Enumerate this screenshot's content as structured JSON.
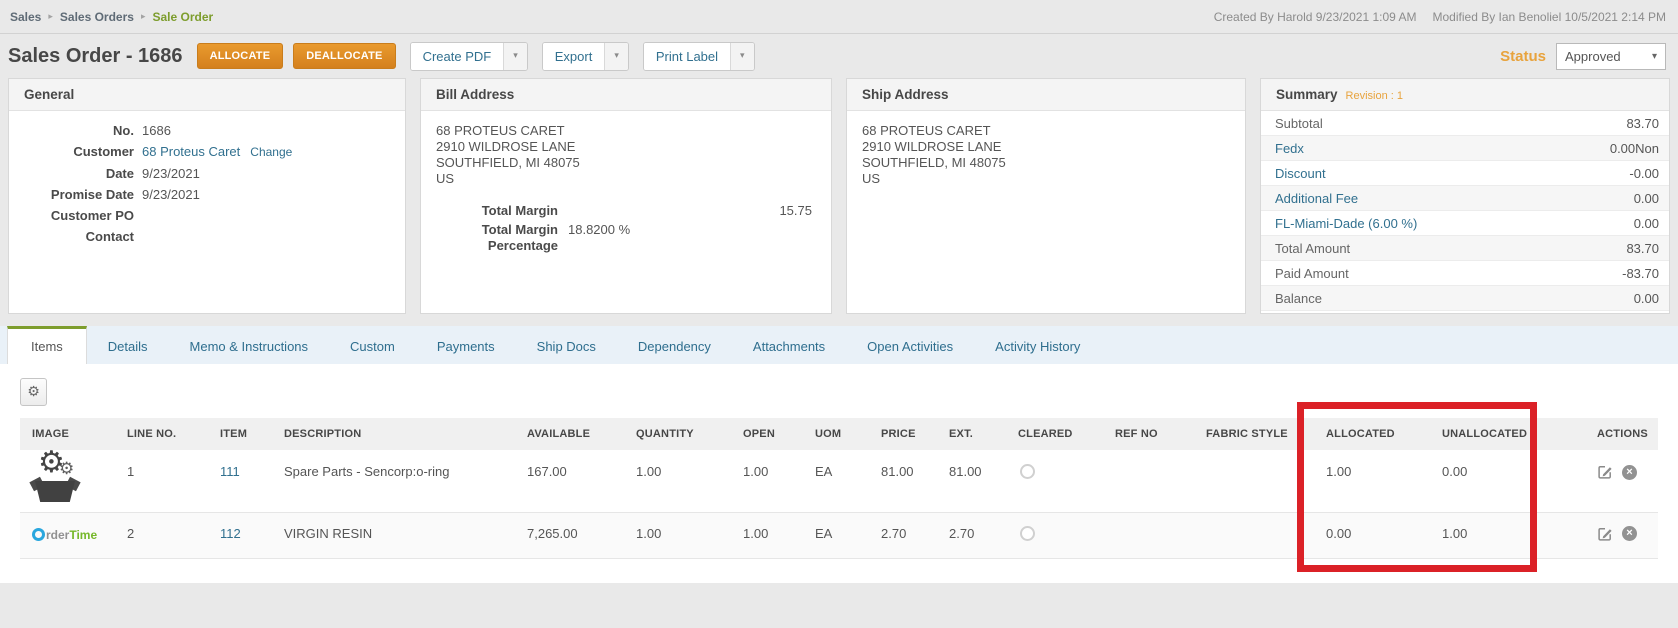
{
  "colors": {
    "accent_orange": "#de8c25",
    "accent_green": "#7d9d2d",
    "link_blue": "#31708f",
    "status_orange": "#e8a33d",
    "highlight_red": "#db2127",
    "tabbar_blue": "#e9f1f8"
  },
  "breadcrumb": {
    "items": [
      "Sales",
      "Sales Orders",
      "Sale Order"
    ]
  },
  "audit": {
    "created": "Created By Harold 9/23/2021 1:09 AM",
    "modified": "Modified By Ian Benoliel 10/5/2021 2:14 PM"
  },
  "header": {
    "title": "Sales Order - 1686",
    "allocate_label": "ALLOCATE",
    "deallocate_label": "DEALLOCATE",
    "create_pdf_label": "Create PDF",
    "export_label": "Export",
    "print_label_label": "Print Label",
    "status_label": "Status",
    "status_value": "Approved"
  },
  "general": {
    "title": "General",
    "rows": [
      {
        "label": "No.",
        "value": "1686"
      },
      {
        "label": "Customer",
        "value": "68 Proteus Caret",
        "extra": "Change"
      },
      {
        "label": "Date",
        "value": "9/23/2021"
      },
      {
        "label": "Promise Date",
        "value": "9/23/2021"
      },
      {
        "label": "Customer PO",
        "value": ""
      },
      {
        "label": "Contact",
        "value": ""
      }
    ]
  },
  "bill_address": {
    "title": "Bill Address",
    "lines": [
      "68 PROTEUS CARET",
      "2910 WILDROSE LANE",
      "SOUTHFIELD, MI 48075",
      "US"
    ],
    "margin_rows": [
      {
        "label": "Total Margin",
        "value": "15.75"
      },
      {
        "label": "Total Margin Percentage",
        "value": "18.8200 %"
      }
    ]
  },
  "ship_address": {
    "title": "Ship Address",
    "lines": [
      "68 PROTEUS CARET",
      "2910 WILDROSE LANE",
      "SOUTHFIELD, MI 48075",
      "US"
    ]
  },
  "summary": {
    "title": "Summary",
    "revision": "Revision : 1",
    "rows": [
      {
        "label": "Subtotal",
        "value": "83.70"
      },
      {
        "label": "Fedx",
        "value": "0.00Non"
      },
      {
        "label": "Discount",
        "value": "-0.00"
      },
      {
        "label": "Additional Fee",
        "value": "0.00"
      },
      {
        "label": "FL-Miami-Dade (6.00 %)",
        "value": "0.00"
      },
      {
        "label": "Total Amount",
        "value": "83.70"
      },
      {
        "label": "Paid Amount",
        "value": "-83.70"
      },
      {
        "label": "Balance",
        "value": "0.00"
      }
    ]
  },
  "tabs": [
    {
      "label": "Items",
      "active": true
    },
    {
      "label": "Details"
    },
    {
      "label": "Memo & Instructions"
    },
    {
      "label": "Custom"
    },
    {
      "label": "Payments"
    },
    {
      "label": "Ship Docs"
    },
    {
      "label": "Dependency"
    },
    {
      "label": "Attachments"
    },
    {
      "label": "Open Activities"
    },
    {
      "label": "Activity History"
    }
  ],
  "items_table": {
    "columns": [
      "IMAGE",
      "LINE NO.",
      "ITEM",
      "DESCRIPTION",
      "AVAILABLE",
      "QUANTITY",
      "OPEN",
      "UOM",
      "PRICE",
      "EXT.",
      "CLEARED",
      "REF NO",
      "FABRIC STYLE",
      "ALLOCATED",
      "UNALLOCATED",
      "ACTIONS"
    ],
    "rows": [
      {
        "image": {
          "type": "spare-parts-icon"
        },
        "line_no": "1",
        "item": "111",
        "description": "Spare Parts - Sencorp:o-ring",
        "available": "167.00",
        "quantity": "1.00",
        "open": "1.00",
        "uom": "EA",
        "price": "81.00",
        "ext": "81.00",
        "ref_no": "",
        "fabric_style": "",
        "allocated": "1.00",
        "unallocated": "0.00"
      },
      {
        "image": {
          "type": "ordertime-logo",
          "text_gray": "rder",
          "text_green": "Time"
        },
        "line_no": "2",
        "item": "112",
        "description": "VIRGIN RESIN",
        "available": "7,265.00",
        "quantity": "1.00",
        "open": "1.00",
        "uom": "EA",
        "price": "2.70",
        "ext": "2.70",
        "ref_no": "",
        "fabric_style": "",
        "allocated": "0.00",
        "unallocated": "1.00"
      }
    ]
  },
  "annotation": {
    "type": "red-rectangle",
    "color": "#db2127"
  }
}
